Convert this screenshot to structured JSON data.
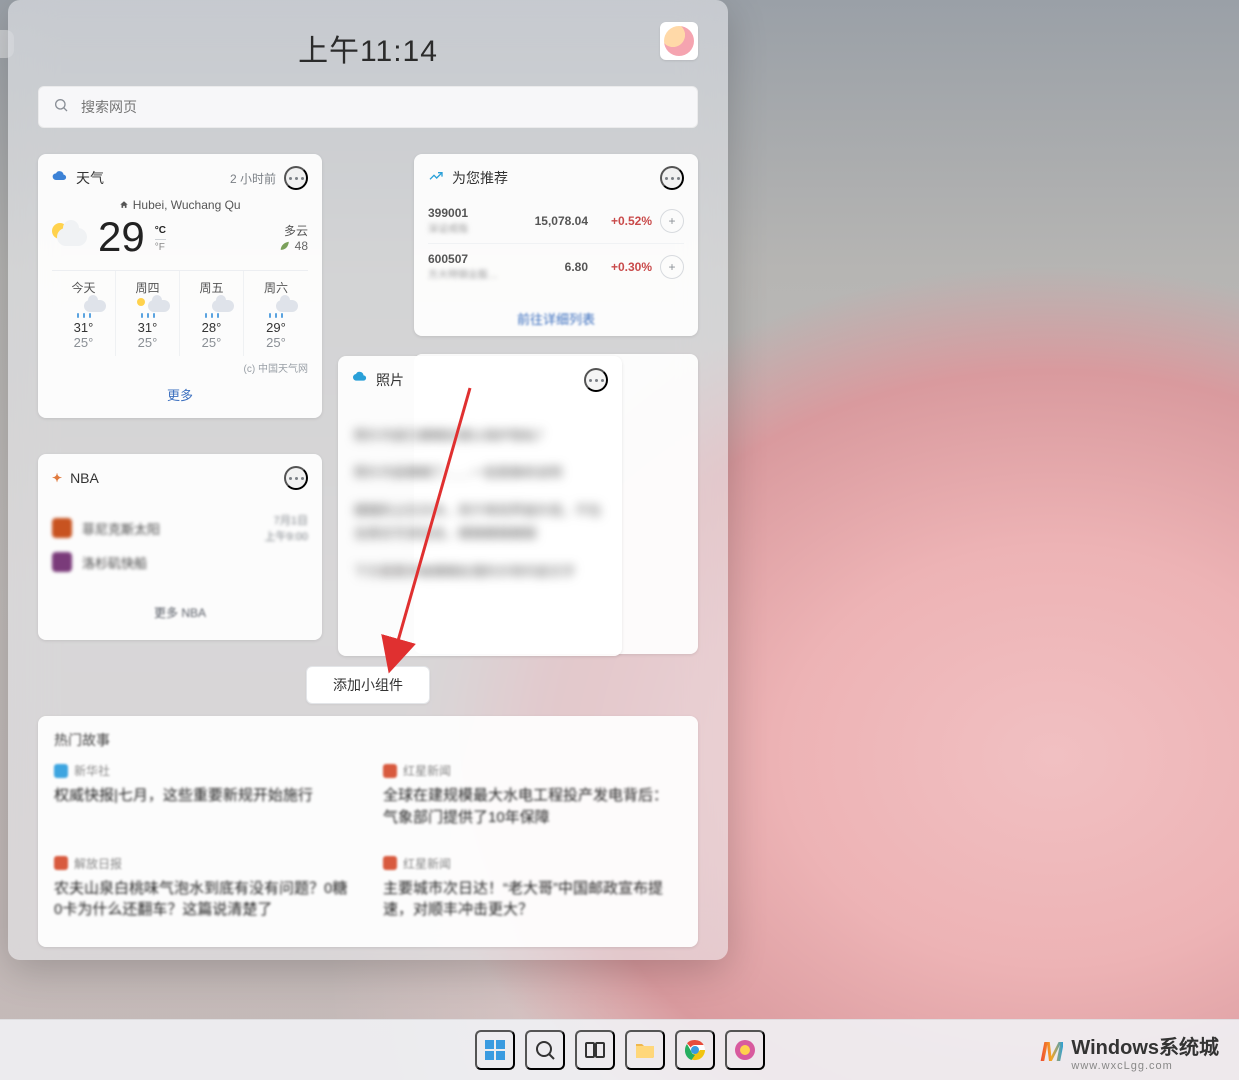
{
  "header": {
    "time": "上午11:14"
  },
  "search": {
    "placeholder": "搜索网页"
  },
  "weather": {
    "title": "天气",
    "age": "2 小时前",
    "location": "Hubei, Wuchang Qu",
    "temp": "29",
    "unit_c": "°C",
    "unit_f": "°F",
    "condition": "多云",
    "aqi_label": "48",
    "forecast": [
      {
        "day": "今天",
        "hi": "31°",
        "lo": "25°",
        "icon": "rain"
      },
      {
        "day": "周四",
        "hi": "31°",
        "lo": "25°",
        "icon": "sunrain"
      },
      {
        "day": "周五",
        "hi": "28°",
        "lo": "25°",
        "icon": "rain"
      },
      {
        "day": "周六",
        "hi": "29°",
        "lo": "25°",
        "icon": "rain"
      }
    ],
    "credit": "(c) 中国天气网",
    "more": "更多"
  },
  "watchlist": {
    "title": "为您推荐",
    "rows": [
      {
        "code": "399001",
        "name": "深证成指",
        "price": "15,078.04",
        "change": "+0.52%"
      },
      {
        "code": "600507",
        "name": "方大特钢业股…",
        "price": "6.80",
        "change": "+0.30%"
      }
    ],
    "link": "前往详细列表"
  },
  "nba": {
    "title": "NBA",
    "teams": [
      {
        "name": "菲尼克斯太阳"
      },
      {
        "name": "洛杉矶快船"
      }
    ],
    "schedule_line1": "7月1日",
    "schedule_line2": "上午9:00",
    "more": "更多 NBA"
  },
  "photos": {
    "title": "照片"
  },
  "add_widget": "添加小组件",
  "feed": {
    "title": "热门故事",
    "items": [
      {
        "source": "新华社",
        "badge": "blue",
        "headline": "权威快报|七月，这些重要新规开始施行"
      },
      {
        "source": "红星新闻",
        "badge": "red",
        "headline": "全球在建规模最大水电工程投产发电背后：气象部门提供了10年保障"
      },
      {
        "source": "解放日报",
        "badge": "red",
        "headline": "农夫山泉白桃味气泡水到底有没有问题？0糖0卡为什么还翻车？这篇说清楚了"
      },
      {
        "source": "红星新闻",
        "badge": "red",
        "headline": "主要城市次日达！“老大哥”中国邮政宣布提速，对顺丰冲击更大？"
      }
    ]
  },
  "watermark": {
    "mark": "M",
    "line1": "Windows系统城",
    "line2": "www.wxcLgg.com"
  }
}
